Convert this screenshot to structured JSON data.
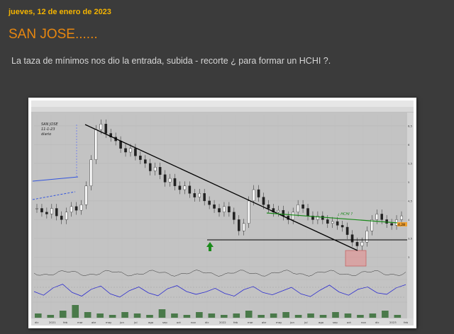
{
  "post": {
    "date": "jueves, 12 de enero de 2023",
    "title": "SAN JOSE......",
    "text": "La taza de mínimos nos dio la entrada, subida - recorte  ¿ para formar un HCHI ?."
  },
  "colors": {
    "background": "#3b3b3b",
    "date": "#f5b400",
    "title": "#e8870f",
    "text": "#d6d6d6",
    "chart_bg": "#c0c0c0",
    "trendline": "#000000",
    "neckline": "#1a8a1a",
    "arrow": "#1a8a1a",
    "support_box": "#e88a8a",
    "indicator_line": "#2a2ad0"
  },
  "chart_data": {
    "type": "candlestick",
    "annotations": {
      "top_left_note": [
        "SAN JOSE",
        "11-1-23",
        "diario"
      ],
      "pattern_label": "¿ HCHI ?"
    },
    "x_tick_labels": [
      "dic",
      "2021",
      "feb",
      "mar",
      "abr",
      "may",
      "jun",
      "jul",
      "ago",
      "sep",
      "oct",
      "nov",
      "dic",
      "2022",
      "feb",
      "mar",
      "abr",
      "may",
      "jun",
      "jul",
      "ago",
      "sep",
      "oct",
      "nov",
      "dic",
      "2023",
      "feb"
    ],
    "y_tick_labels": [
      "6,5",
      "6",
      "5,5",
      "5",
      "4,5",
      "4",
      "3,5",
      "3"
    ],
    "price_tag": "4,28",
    "close_series": [
      4.3,
      4.2,
      4.15,
      4.3,
      4.1,
      4.0,
      4.2,
      4.35,
      4.25,
      4.4,
      4.9,
      5.6,
      6.4,
      6.55,
      6.3,
      6.2,
      6.1,
      5.9,
      5.8,
      5.9,
      5.7,
      5.6,
      5.5,
      5.3,
      5.4,
      5.2,
      5.0,
      5.1,
      4.9,
      4.8,
      4.9,
      4.7,
      4.6,
      4.7,
      4.5,
      4.4,
      4.3,
      4.2,
      4.35,
      4.2,
      4.0,
      3.7,
      3.9,
      4.5,
      4.8,
      4.6,
      4.4,
      4.3,
      4.2,
      4.25,
      4.1,
      4.0,
      4.2,
      4.4,
      4.3,
      4.1,
      4.0,
      4.1,
      4.0,
      3.9,
      3.95,
      3.85,
      3.8,
      3.6,
      3.4,
      3.3,
      3.4,
      3.7,
      4.0,
      4.15,
      4.0,
      3.9,
      3.85,
      4.0,
      4.1
    ],
    "rsi_series": [
      50,
      42,
      58,
      66,
      48,
      40,
      55,
      62,
      45,
      38,
      52,
      60,
      47,
      41,
      56,
      63,
      50,
      44,
      49,
      57,
      46,
      40,
      54,
      61,
      48,
      43,
      51,
      59,
      45,
      39,
      53,
      64,
      49,
      42,
      55,
      60,
      47,
      44,
      58,
      65
    ],
    "volume_series": [
      3,
      2,
      5,
      9,
      4,
      3,
      2,
      4,
      3,
      2,
      6,
      3,
      2,
      4,
      3,
      2,
      3,
      5,
      2,
      3,
      4,
      2,
      3,
      2,
      4,
      3,
      2,
      3,
      5,
      2
    ]
  }
}
